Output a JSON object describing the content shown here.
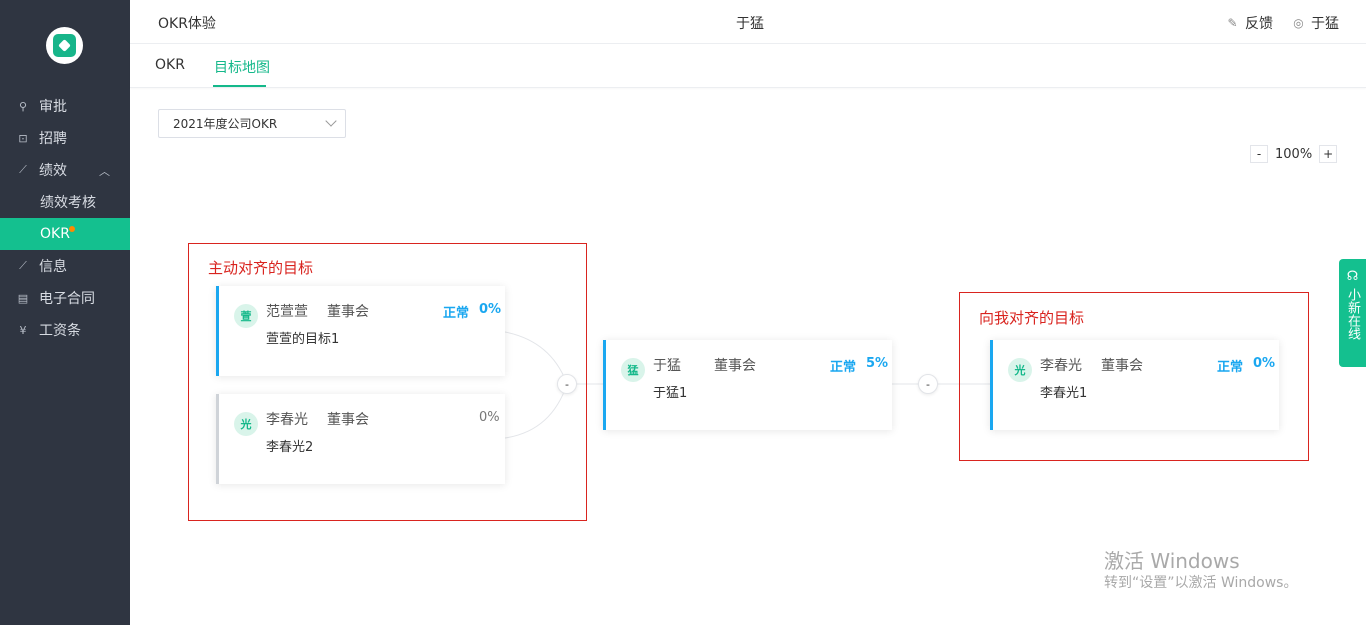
{
  "sidebar": {
    "items": [
      {
        "label": "审批",
        "icon": "stamp-icon"
      },
      {
        "label": "招聘",
        "icon": "recruit-icon"
      },
      {
        "label": "绩效",
        "icon": "chart-icon"
      },
      {
        "label": "绩效考核"
      },
      {
        "label": "OKR"
      },
      {
        "label": "信息",
        "icon": "info-chart-icon"
      },
      {
        "label": "电子合同",
        "icon": "contract-icon"
      },
      {
        "label": "工资条",
        "icon": "yen-icon"
      }
    ]
  },
  "header": {
    "title": "OKR体验",
    "center_user": "于猛",
    "feedback": "反馈",
    "user": "于猛"
  },
  "tabs": [
    {
      "label": "OKR"
    },
    {
      "label": "目标地图"
    }
  ],
  "select": {
    "value": "2021年度公司OKR"
  },
  "zoom": {
    "minus": "-",
    "value": "100%",
    "plus": "+"
  },
  "annotations": {
    "left": "主动对齐的目标",
    "right": "向我对齐的目标"
  },
  "cards": [
    {
      "avatar": "萱",
      "name": "范萱萱",
      "dept": "董事会",
      "status": "正常",
      "pct": "0%",
      "goal": "萱萱的目标1"
    },
    {
      "avatar": "光",
      "name": "李春光",
      "dept": "董事会",
      "status": "",
      "pct": "0%",
      "goal": "李春光2"
    },
    {
      "avatar": "猛",
      "name": "于猛",
      "dept": "董事会",
      "status": "正常",
      "pct": "5%",
      "goal": "于猛1"
    },
    {
      "avatar": "光",
      "name": "李春光",
      "dept": "董事会",
      "status": "正常",
      "pct": "0%",
      "goal": "李春光1"
    }
  ],
  "connectors": [
    "-",
    "-"
  ],
  "support": {
    "label": "小新在线"
  },
  "watermark": {
    "line1": "激活 Windows",
    "line2": "转到“设置”以激活 Windows。"
  },
  "colors": {
    "sidebar_bg": "#2f3541",
    "accent": "#14c08f",
    "blue": "#1aa7f0",
    "annotation": "#d9241f"
  }
}
